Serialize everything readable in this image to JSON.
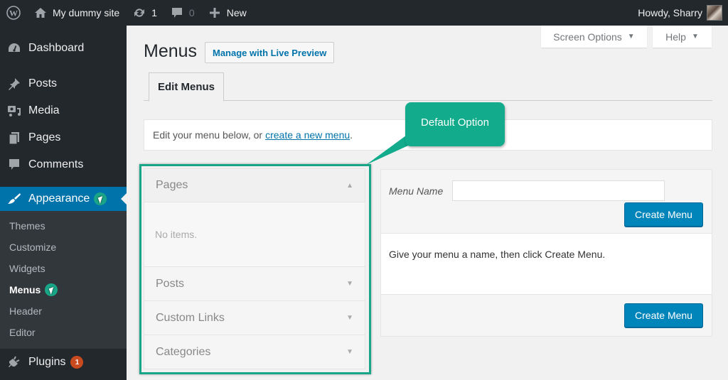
{
  "adminbar": {
    "logo_icon": "wordpress-logo-icon",
    "site_name": "My dummy site",
    "site_icon": "home-icon",
    "updates_icon": "updates-icon",
    "updates_count": "1",
    "comments_icon": "comment-icon",
    "comments_count": "0",
    "new_icon": "plus-icon",
    "new_label": "New",
    "greeting": "Howdy, Sharry"
  },
  "sidebar": {
    "items": [
      {
        "label": "Dashboard",
        "icon": "dashboard-icon"
      },
      {
        "label": "Posts",
        "icon": "pin-icon"
      },
      {
        "label": "Media",
        "icon": "media-icon"
      },
      {
        "label": "Pages",
        "icon": "pages-icon"
      },
      {
        "label": "Comments",
        "icon": "comment-icon"
      },
      {
        "label": "Appearance",
        "icon": "paintbrush-icon"
      },
      {
        "label": "Plugins",
        "icon": "plugin-icon",
        "badge": "1"
      }
    ],
    "submenu": [
      "Themes",
      "Customize",
      "Widgets",
      "Menus",
      "Header",
      "Editor"
    ],
    "current_submenu": "Menus"
  },
  "screen_meta": {
    "screen_options": "Screen Options",
    "help": "Help"
  },
  "main": {
    "title": "Menus",
    "live_preview": "Manage with Live Preview",
    "tab": "Edit Menus",
    "notice_text": "Edit your menu below, or",
    "notice_link": "create a new menu",
    "notice_end": "."
  },
  "accordion": {
    "sections": [
      {
        "title": "Pages",
        "expanded": true,
        "body": "No items."
      },
      {
        "title": "Posts",
        "expanded": false
      },
      {
        "title": "Custom Links",
        "expanded": false
      },
      {
        "title": "Categories",
        "expanded": false
      }
    ]
  },
  "annotation": {
    "callout": "Default Option",
    "color": "#19a587"
  },
  "menu_panel": {
    "name_label": "Menu Name",
    "name_value": "",
    "name_placeholder": "",
    "create_button": "Create Menu",
    "instructions": "Give your menu a name, then click Create Menu.",
    "create_button_bottom": "Create Menu"
  },
  "colors": {
    "adminbar_bg": "#23282d",
    "accent": "#0073aa",
    "primary_button": "#0085ba",
    "badge": "#ca4a1f",
    "highlight": "#19a587"
  }
}
